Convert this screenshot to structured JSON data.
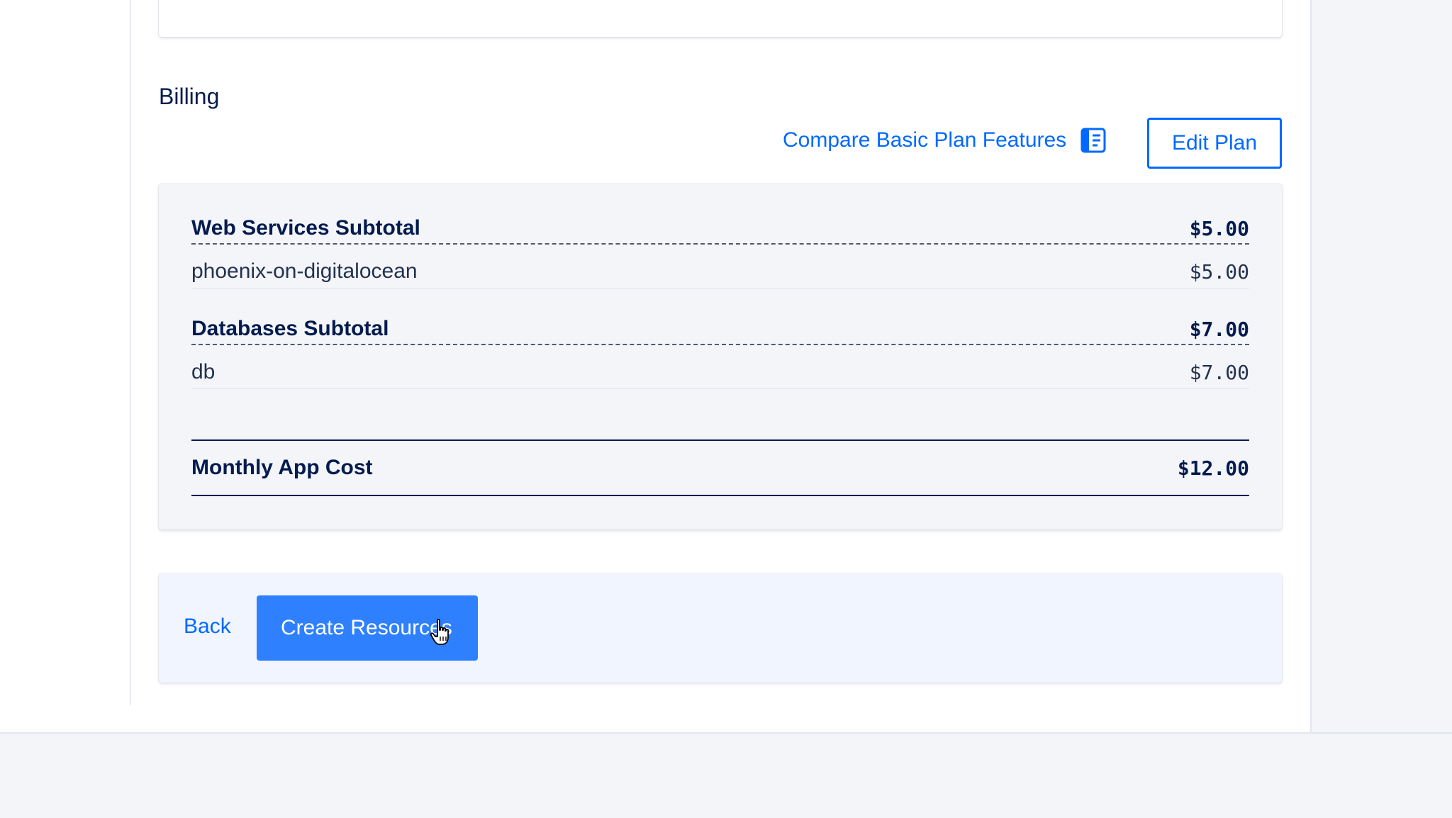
{
  "billing": {
    "title": "Billing",
    "compare_link": "Compare Basic Plan Features",
    "edit_plan_label": "Edit Plan",
    "groups": [
      {
        "subtotal_label": "Web Services Subtotal",
        "subtotal_amount": "$5.00",
        "items": [
          {
            "name": "phoenix-on-digitalocean",
            "amount": "$5.00"
          }
        ]
      },
      {
        "subtotal_label": "Databases Subtotal",
        "subtotal_amount": "$7.00",
        "items": [
          {
            "name": "db",
            "amount": "$7.00"
          }
        ]
      }
    ],
    "total_label": "Monthly App Cost",
    "total_amount": "$12.00"
  },
  "actions": {
    "back_label": "Back",
    "create_label": "Create Resources"
  },
  "colors": {
    "accent": "#0069ff",
    "primary_button": "#2f80ff",
    "text_dark": "#031b4e",
    "card_bg": "#f3f5f9",
    "action_bar_bg": "#f0f5ff"
  },
  "icons": {
    "compare": "document-list-icon",
    "cursor": "hand-pointer-icon"
  }
}
